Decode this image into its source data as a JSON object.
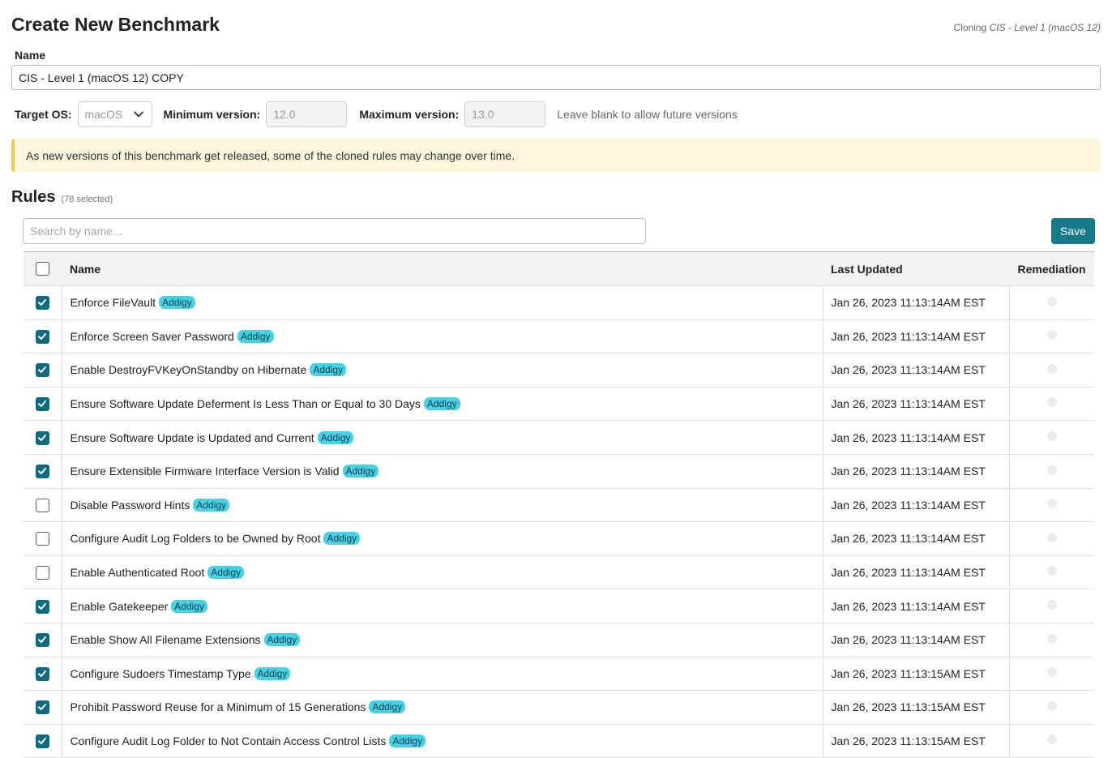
{
  "header": {
    "title": "Create New Benchmark",
    "clone_prefix": "Cloning",
    "clone_source": "CIS - Level 1 (macOS 12)"
  },
  "form": {
    "name_label": "Name",
    "name_value": "CIS - Level 1 (macOS 12) COPY",
    "target_os_label": "Target OS:",
    "target_os_value": "macOS",
    "min_version_label": "Minimum version:",
    "min_version_value": "12.0",
    "max_version_label": "Maximum version:",
    "max_version_value": "13.0",
    "version_hint": "Leave blank to allow future versions"
  },
  "banner": {
    "text": "As new versions of this benchmark get released, some of the cloned rules may change over time."
  },
  "rules": {
    "title": "Rules",
    "selected_count": "(78 selected)",
    "search_placeholder": "Search by name...",
    "save_label": "Save",
    "columns": {
      "name": "Name",
      "last_updated": "Last Updated",
      "remediation": "Remediation"
    },
    "rows": [
      {
        "checked": true,
        "name": "Enforce FileVault",
        "badge": "Addigy",
        "updated": "Jan 26, 2023 11:13:14AM EST"
      },
      {
        "checked": true,
        "name": "Enforce Screen Saver Password",
        "badge": "Addigy",
        "updated": "Jan 26, 2023 11:13:14AM EST"
      },
      {
        "checked": true,
        "name": "Enable DestroyFVKeyOnStandby on Hibernate",
        "badge": "Addigy",
        "updated": "Jan 26, 2023 11:13:14AM EST"
      },
      {
        "checked": true,
        "name": "Ensure Software Update Deferment Is Less Than or Equal to 30 Days",
        "badge": "Addigy",
        "updated": "Jan 26, 2023 11:13:14AM EST"
      },
      {
        "checked": true,
        "name": "Ensure Software Update is Updated and Current",
        "badge": "Addigy",
        "updated": "Jan 26, 2023 11:13:14AM EST"
      },
      {
        "checked": true,
        "name": "Ensure Extensible Firmware Interface Version is Valid",
        "badge": "Addigy",
        "updated": "Jan 26, 2023 11:13:14AM EST"
      },
      {
        "checked": false,
        "name": "Disable Password Hints",
        "badge": "Addigy",
        "updated": "Jan 26, 2023 11:13:14AM EST"
      },
      {
        "checked": false,
        "name": "Configure Audit Log Folders to be Owned by Root",
        "badge": "Addigy",
        "updated": "Jan 26, 2023 11:13:14AM EST"
      },
      {
        "checked": false,
        "name": "Enable Authenticated Root",
        "badge": "Addigy",
        "updated": "Jan 26, 2023 11:13:14AM EST"
      },
      {
        "checked": true,
        "name": "Enable Gatekeeper",
        "badge": "Addigy",
        "updated": "Jan 26, 2023 11:13:14AM EST"
      },
      {
        "checked": true,
        "name": "Enable Show All Filename Extensions",
        "badge": "Addigy",
        "updated": "Jan 26, 2023 11:13:14AM EST"
      },
      {
        "checked": true,
        "name": "Configure Sudoers Timestamp Type",
        "badge": "Addigy",
        "updated": "Jan 26, 2023 11:13:15AM EST"
      },
      {
        "checked": true,
        "name": "Prohibit Password Reuse for a Minimum of 15 Generations",
        "badge": "Addigy",
        "updated": "Jan 26, 2023 11:13:15AM EST"
      },
      {
        "checked": true,
        "name": "Configure Audit Log Folder to Not Contain Access Control Lists",
        "badge": "Addigy",
        "updated": "Jan 26, 2023 11:13:15AM EST"
      }
    ]
  },
  "colors": {
    "accent": "#177a8a",
    "checkbox_on": "#0e6b7d",
    "badge": "#48d0e3",
    "banner_bg": "#fdf5dc",
    "banner_border": "#f4c44e"
  },
  "icons": {
    "os_select": "chevron-down-icon",
    "checkbox": "checkmark-icon",
    "remediation": "status-dot-icon"
  }
}
